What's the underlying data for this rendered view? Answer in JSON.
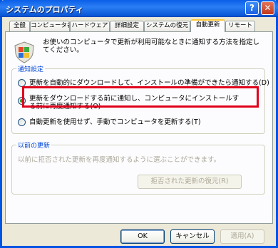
{
  "window": {
    "title": "システムのプロパティ"
  },
  "titlebar_buttons": {
    "help": "?",
    "close": "✕"
  },
  "tabs": [
    {
      "label": "全般"
    },
    {
      "label": "コンピュータ名"
    },
    {
      "label": "ハードウェア"
    },
    {
      "label": "詳細設定"
    },
    {
      "label": "システムの復元"
    },
    {
      "label": "自動更新",
      "active": true
    },
    {
      "label": "リモート"
    }
  ],
  "intro": "お使いのコンピュータで更新が利用可能なときに通知する方法を指定してください。",
  "notification_group": {
    "title": "通知設定",
    "options": [
      {
        "label": "更新を自動的にダウンロードして、インストールの準備ができたら通知する(D)",
        "checked": false
      },
      {
        "label": "更新をダウンロードする前に通知し、コンピュータにインストールする前に再度通知する(O)",
        "checked": true
      },
      {
        "label": "自動更新を使用せず、手動でコンピュータを更新する(T)",
        "checked": false
      }
    ]
  },
  "previous_group": {
    "title": "以前の更新",
    "description": "以前に拒否された更新を再度通知するように選ぶことができます。",
    "restore_button": "拒否された更新の復元(R)"
  },
  "footer": {
    "ok": "OK",
    "cancel": "キャンセル",
    "apply": "適用(A)"
  },
  "colors": {
    "titlebar": "#0a5ee8",
    "highlight_border": "#e0001a",
    "group_title": "#0046d5"
  }
}
